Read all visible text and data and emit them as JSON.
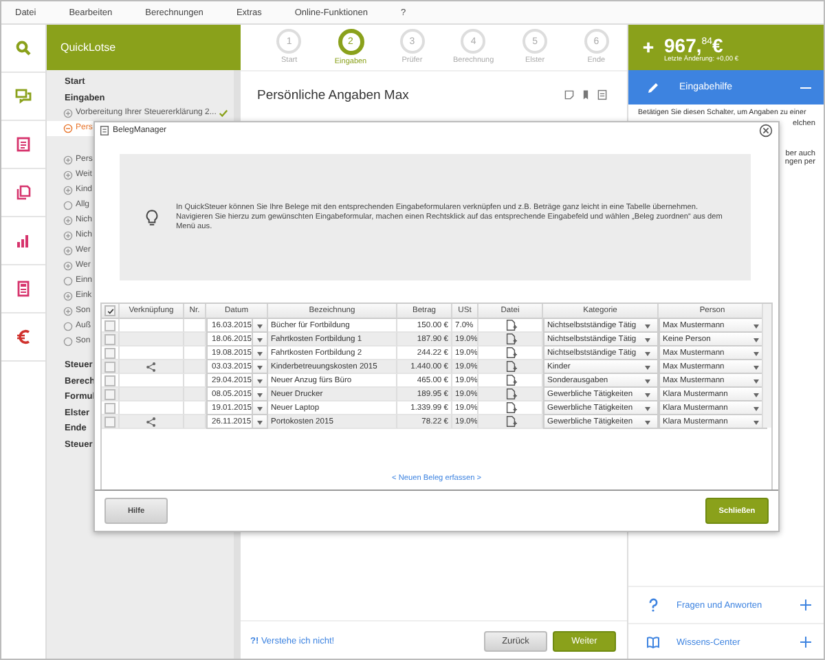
{
  "menu": [
    "Datei",
    "Bearbeiten",
    "Berechnungen",
    "Extras",
    "Online-Funktionen",
    "?"
  ],
  "sidebar": {
    "title": "QuickLotse",
    "sections": [
      {
        "title": "Start"
      },
      {
        "title": "Eingaben",
        "items": [
          {
            "label": "Vorbereitung Ihrer Steuererklärung 2...",
            "kind": "folder",
            "expanded": false,
            "selected": false,
            "done": true
          },
          {
            "label": "Pers",
            "kind": "folder",
            "expanded": true,
            "selected": true
          },
          {
            "label": "Pers",
            "kind": "folder",
            "expanded": false,
            "selected": false
          },
          {
            "label": "Weit",
            "kind": "folder",
            "expanded": false,
            "selected": false
          },
          {
            "label": "Kind",
            "kind": "folder",
            "expanded": false,
            "selected": false
          },
          {
            "label": "Allg",
            "kind": "page",
            "selected": false
          },
          {
            "label": "Nich",
            "kind": "folder",
            "expanded": false,
            "selected": false
          },
          {
            "label": "Nich",
            "kind": "folder",
            "expanded": false,
            "selected": false
          },
          {
            "label": "Wer",
            "kind": "folder",
            "expanded": false,
            "selected": false
          },
          {
            "label": "Wer",
            "kind": "folder",
            "expanded": false,
            "selected": false
          },
          {
            "label": "Einn",
            "kind": "page",
            "selected": false
          },
          {
            "label": "Eink",
            "kind": "folder",
            "expanded": false,
            "selected": false
          },
          {
            "label": "Son",
            "kind": "folder",
            "expanded": false,
            "selected": false
          },
          {
            "label": "Auß",
            "kind": "page",
            "selected": false
          },
          {
            "label": "Son",
            "kind": "page",
            "selected": false
          }
        ]
      },
      {
        "title": "Steuer"
      },
      {
        "title": "Berech"
      },
      {
        "title": "Formul"
      },
      {
        "title": "Elster"
      },
      {
        "title": "Ende"
      },
      {
        "title": "Steuer"
      }
    ]
  },
  "steps": [
    {
      "number": "1",
      "label": "Start",
      "selected": false
    },
    {
      "number": "2",
      "label": "Eingaben",
      "selected": true
    },
    {
      "number": "3",
      "label": "Prüfer",
      "selected": false
    },
    {
      "number": "4",
      "label": "Berechnung",
      "selected": false
    },
    {
      "number": "5",
      "label": "Elster",
      "selected": false
    },
    {
      "number": "6",
      "label": "Ende",
      "selected": false
    }
  ],
  "page_title": "Persönliche Angaben Max",
  "balance": {
    "amount": "967,$^{84}$€",
    "last_change": "Letzte Änderung: +0,00 €"
  },
  "help": {
    "title": "Eingabehilfe",
    "expanded": true,
    "text": "Betätigen Sie diesen Schalter, um Angaben zu einer",
    "fragments": [
      "elchen",
      "ber auch",
      "ngen per"
    ]
  },
  "help_links": [
    {
      "label": "Fragen und Anworten",
      "kind": "faq",
      "expanded": false
    },
    {
      "label": "Wissens-Center",
      "kind": "book",
      "expanded": false
    }
  ],
  "footer": {
    "help_link": "**?!** Verstehe ich nicht!",
    "back": "Zurück",
    "next": "Weiter"
  },
  "dialog": {
    "title": "BelegManager",
    "info": "In QuickSteuer können Sie Ihre Belege mit den entsprechenden Eingabeformularen verknüpfen und z.B. Beträge ganz leicht in eine Tabelle übernehmen. Navigieren Sie hierzu zum gewünschten Eingabeformular, machen einen Rechtsklick auf das entsprechende Eingabefeld und wählen „Beleg zuordnen“ aus dem Menü aus.",
    "select_all": true,
    "columns": [
      "Verknüpfung",
      "Nr.",
      "Datum",
      "Bezeichnung",
      "Betrag",
      "USt",
      "Datei",
      "Kategorie",
      "Person"
    ],
    "rows": [
      {
        "checked": false,
        "linked": false,
        "date": "16.03.2015",
        "description": "Bücher für Fortbildung",
        "amount": "150.00 €",
        "vat": "7.0%",
        "category": "Nichtselbstständige Tätig",
        "person": "Max Mustermann"
      },
      {
        "checked": false,
        "linked": false,
        "date": "18.06.2015",
        "description": "Fahrtkosten Fortbildung 1",
        "amount": "187.90 €",
        "vat": "19.0%",
        "category": "Nichtselbstständige Tätig",
        "person": "Keine Person"
      },
      {
        "checked": false,
        "linked": false,
        "date": "19.08.2015",
        "description": "Fahrtkosten Fortbildung 2",
        "amount": "244.22 €",
        "vat": "19.0%",
        "category": "Nichtselbstständige Tätig",
        "person": "Max Mustermann"
      },
      {
        "checked": false,
        "linked": true,
        "date": "03.03.2015",
        "description": "Kinderbetreuungskosten 2015",
        "amount": "1.440.00 €",
        "vat": "19.0%",
        "category": "Kinder",
        "person": "Max Mustermann"
      },
      {
        "checked": false,
        "linked": false,
        "date": "29.04.2015",
        "description": "Neuer Anzug fürs Büro",
        "amount": "465.00 €",
        "vat": "19.0%",
        "category": "Sonderausgaben",
        "person": "Max Mustermann"
      },
      {
        "checked": false,
        "linked": false,
        "date": "08.05.2015",
        "description": "Neuer Drucker",
        "amount": "189.95 €",
        "vat": "19.0%",
        "category": "Gewerbliche Tätigkeiten",
        "person": "Klara Mustermann"
      },
      {
        "checked": false,
        "linked": false,
        "date": "19.01.2015",
        "description": "Neuer Laptop",
        "amount": "1.339.99 €",
        "vat": "19.0%",
        "category": "Gewerbliche Tätigkeiten",
        "person": "Klara Mustermann"
      },
      {
        "checked": false,
        "linked": true,
        "date": "26.11.2015",
        "description": "Portokosten 2015",
        "amount": "78.22 €",
        "vat": "19.0%",
        "category": "Gewerbliche Tätigkeiten",
        "person": "Klara Mustermann"
      }
    ],
    "new_link": "< Neuen Beleg erfassen >",
    "help_button": "Hilfe",
    "close_button": "Schließen"
  }
}
